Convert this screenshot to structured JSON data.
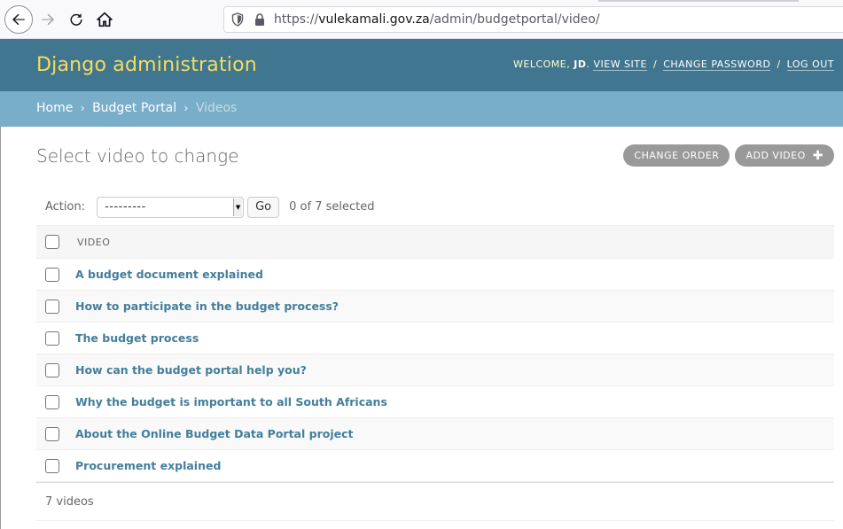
{
  "browser": {
    "url_scheme": "https://",
    "url_host": "vulekamali.gov.za",
    "url_path": "/admin/budgetportal/video/"
  },
  "header": {
    "branding": "Django administration",
    "welcome": "WELCOME,",
    "username": "JD",
    "view_site": "VIEW SITE",
    "change_password": "CHANGE PASSWORD",
    "log_out": "LOG OUT",
    "separator": "/"
  },
  "breadcrumbs": {
    "home": "Home",
    "app": "Budget Portal",
    "current": "Videos",
    "separator": "›"
  },
  "content": {
    "title": "Select video to change",
    "change_order": "CHANGE ORDER",
    "add_video": "ADD VIDEO",
    "add_icon": "plus-icon"
  },
  "actions": {
    "label": "Action:",
    "selected_option": "---------",
    "go": "Go",
    "counter": "0 of 7 selected"
  },
  "table": {
    "column": "VIDEO",
    "rows": [
      "A budget document explained",
      "How to participate in the budget process?",
      "The budget process",
      "How can the budget portal help you?",
      "Why the budget is important to all South Africans",
      "About the Online Budget Data Portal project",
      "Procurement explained"
    ]
  },
  "paginator": "7 videos",
  "colors": {
    "header_bg": "#417690",
    "branding": "#f5dd5d",
    "breadcrumbs_bg": "#79aec8",
    "link": "#447e9b"
  }
}
